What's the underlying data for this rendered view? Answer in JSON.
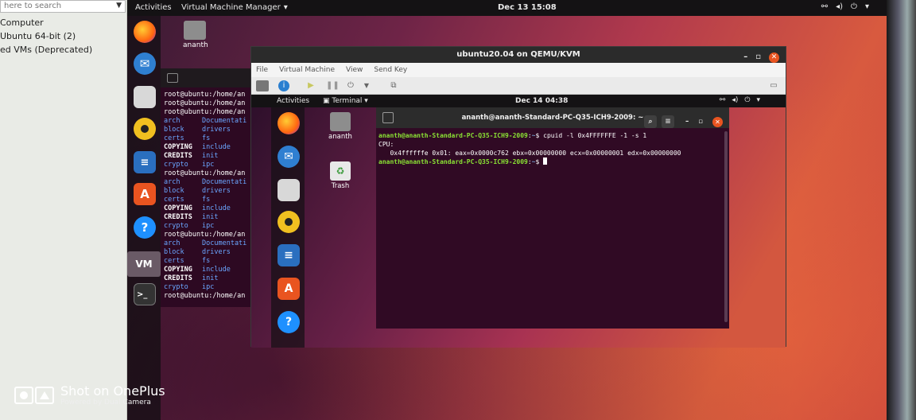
{
  "left_panel": {
    "search_placeholder": "here to search",
    "items": [
      "Computer",
      "Ubuntu 64-bit (2)",
      "ed VMs (Deprecated)"
    ]
  },
  "host": {
    "topbar": {
      "activities": "Activities",
      "app_menu": "Virtual Machine Manager",
      "clock": "Dec 13  15:08"
    },
    "desktop_file": "ananth",
    "terminal": {
      "lines": [
        {
          "t": "r",
          "text": "root@ubuntu:/home/an"
        },
        {
          "t": "r",
          "text": "root@ubuntu:/home/an"
        },
        {
          "t": "r",
          "text": "root@ubuntu:/home/an"
        },
        {
          "t": "c",
          "a": "arch",
          "b": "Documentati",
          "w": false
        },
        {
          "t": "c",
          "a": "block",
          "b": "drivers",
          "w": false
        },
        {
          "t": "c",
          "a": "certs",
          "b": "fs",
          "w": false
        },
        {
          "t": "c",
          "a": "COPYING",
          "b": "include",
          "w": true
        },
        {
          "t": "c",
          "a": "CREDITS",
          "b": "init",
          "w": true
        },
        {
          "t": "c",
          "a": "crypto",
          "b": "ipc",
          "w": false
        },
        {
          "t": "r",
          "text": "root@ubuntu:/home/an"
        },
        {
          "t": "c",
          "a": "arch",
          "b": "Documentati",
          "w": false
        },
        {
          "t": "c",
          "a": "block",
          "b": "drivers",
          "w": false
        },
        {
          "t": "c",
          "a": "certs",
          "b": "fs",
          "w": false
        },
        {
          "t": "c",
          "a": "COPYING",
          "b": "include",
          "w": true
        },
        {
          "t": "c",
          "a": "CREDITS",
          "b": "init",
          "w": true
        },
        {
          "t": "c",
          "a": "crypto",
          "b": "ipc",
          "w": false
        },
        {
          "t": "r",
          "text": "root@ubuntu:/home/an"
        },
        {
          "t": "c",
          "a": "arch",
          "b": "Documentati",
          "w": false
        },
        {
          "t": "c",
          "a": "block",
          "b": "drivers",
          "w": false
        },
        {
          "t": "c",
          "a": "certs",
          "b": "fs",
          "w": false
        },
        {
          "t": "c",
          "a": "COPYING",
          "b": "include",
          "w": true
        },
        {
          "t": "c",
          "a": "CREDITS",
          "b": "init",
          "w": true
        },
        {
          "t": "c",
          "a": "crypto",
          "b": "ipc",
          "w": false
        },
        {
          "t": "r",
          "text": "root@ubuntu:/home/an"
        }
      ]
    }
  },
  "vm": {
    "title": "ubuntu20.04 on QEMU/KVM",
    "menu": [
      "File",
      "Virtual Machine",
      "View",
      "Send Key"
    ],
    "guest": {
      "topbar": {
        "activities": "Activities",
        "app_menu": "Terminal",
        "clock": "Dec 14  04:38"
      },
      "desktop_files": [
        "ananth",
        "Trash"
      ],
      "terminal": {
        "title": "ananth@ananth-Standard-PC-Q35-ICH9-2009: ~",
        "prompt_user": "ananth@ananth-Standard-PC-Q35-ICH9-2009",
        "prompt_path": "~",
        "command": "cpuid -l 0x4FFFFFFE -1 -s 1",
        "out_line1": "CPU:",
        "out_line2": "   0x4ffffffe 0x01: eax=0x0000c762 ebx=0x00000000 ecx=0x00000001 edx=0x00000000"
      }
    }
  },
  "watermark": {
    "line1": "Shot on OnePlus",
    "line2": "Powered by Dual Camera"
  }
}
